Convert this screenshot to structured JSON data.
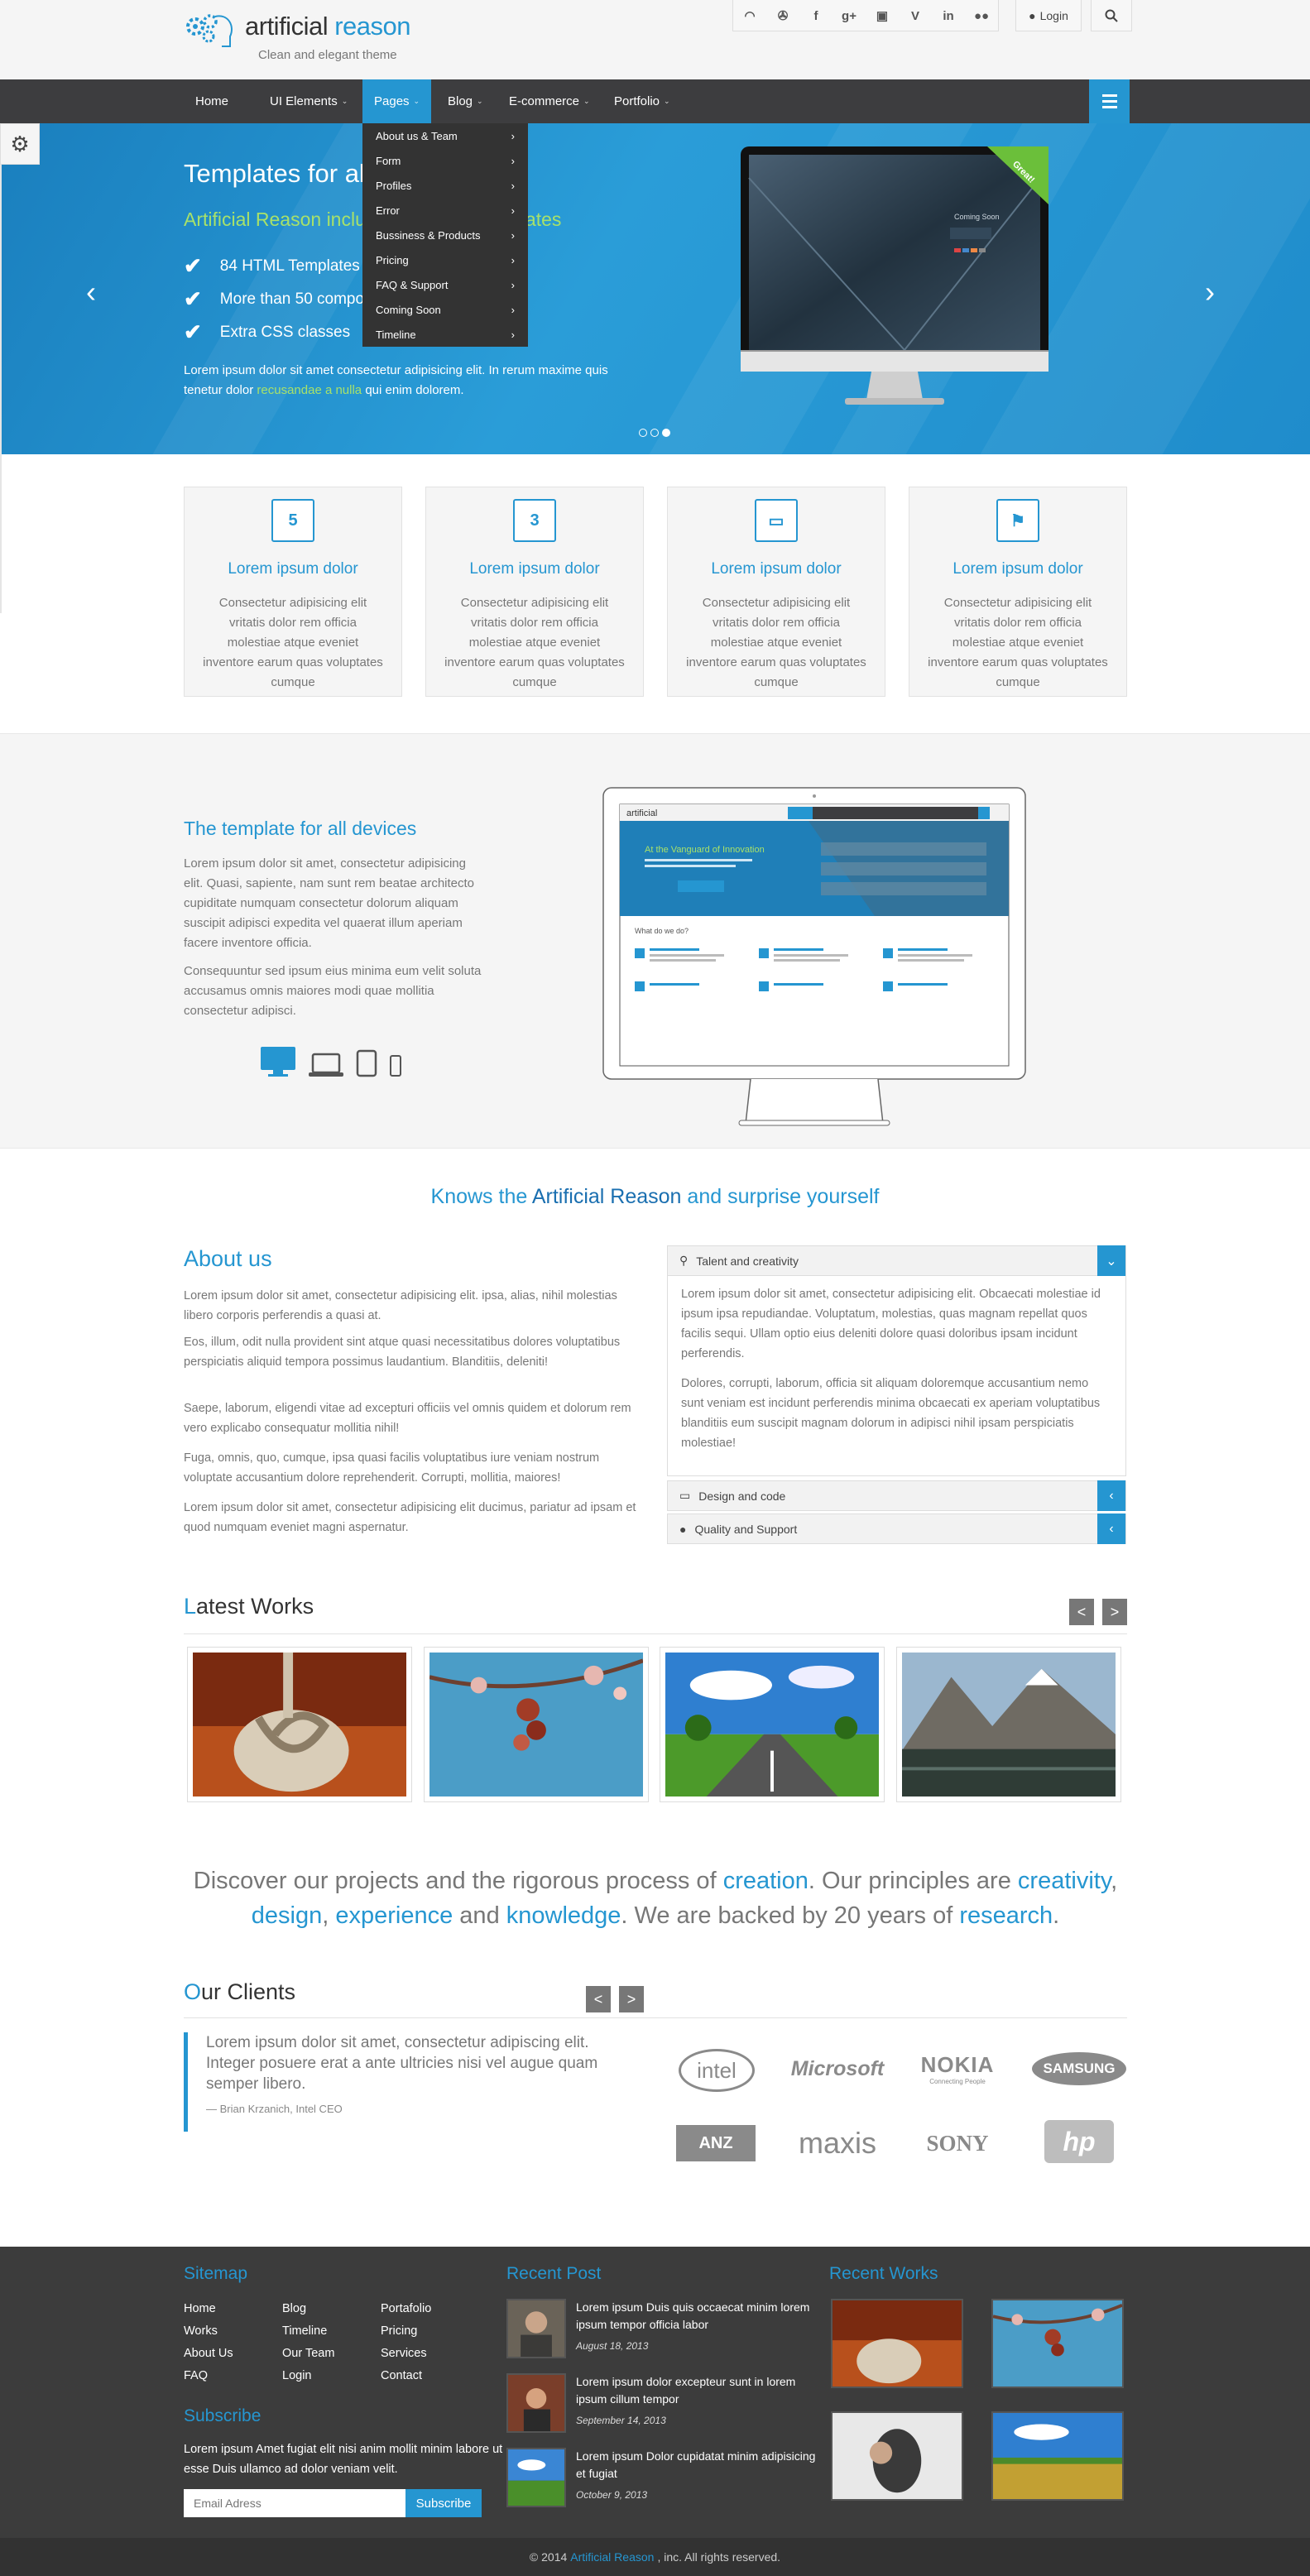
{
  "brand": {
    "title_part1": "artificial",
    "title_part2": "reason",
    "tagline": "Clean and elegant theme"
  },
  "topbar": {
    "social_icons": [
      "rss-icon",
      "twitter-icon",
      "facebook-icon",
      "google-plus-icon",
      "instagram-icon",
      "vine-icon",
      "linkedin-icon",
      "flickr-icon"
    ],
    "social_glyphs": [
      "◠",
      "✇",
      "f",
      "g+",
      "▣",
      "V",
      "in",
      "●●"
    ],
    "login": "Login"
  },
  "nav": {
    "items": [
      "Home",
      "UI Elements",
      "Pages",
      "Blog",
      "E-commerce",
      "Portfolio"
    ],
    "active": "Pages"
  },
  "dropdown": [
    "About us & Team",
    "Form",
    "Profiles",
    "Error",
    "Bussiness & Products",
    "Pricing",
    "FAQ & Support",
    "Coming Soon",
    "Timeline"
  ],
  "hero": {
    "title": "Templates for all devices",
    "subtitle": "Artificial Reason includes amazing templates",
    "checks": [
      "84 HTML Templates",
      "More than 50 components",
      "Extra CSS classes"
    ],
    "paragraph_a": "Lorem ipsum dolor sit amet consectetur adipisicing elit. In rerum maxime quis tenetur dolor ",
    "paragraph_link": "recusandae a nulla",
    "paragraph_b": " qui enim dolorem.",
    "ribbon": "Great!",
    "monitor_screen": "Coming Soon"
  },
  "features": [
    {
      "icon": "html5-icon",
      "glyph": "5",
      "title": "Lorem ipsum dolor",
      "text": "Consectetur adipisicing elit vritatis dolor rem officia molestiae atque eveniet inventore earum quas voluptates cumque"
    },
    {
      "icon": "css3-icon",
      "glyph": "3",
      "title": "Lorem ipsum dolor",
      "text": "Consectetur adipisicing elit vritatis dolor rem officia molestiae atque eveniet inventore earum quas voluptates cumque"
    },
    {
      "icon": "desktop-icon",
      "glyph": "▭",
      "title": "Lorem ipsum dolor",
      "text": "Consectetur adipisicing elit vritatis dolor rem officia molestiae atque eveniet inventore earum quas voluptates cumque"
    },
    {
      "icon": "flag-icon",
      "glyph": "⚑",
      "title": "Lorem ipsum dolor",
      "text": "Consectetur adipisicing elit vritatis dolor rem officia molestiae atque eveniet inventore earum quas voluptates cumque"
    }
  ],
  "devices": {
    "title": "The template for all devices",
    "p1": "Lorem ipsum dolor sit amet, consectetur adipisicing elit. Quasi, sapiente, nam sunt rem beatae architecto cupiditate numquam consectetur dolorum aliquam suscipit adipisci expedita vel quaerat illum aperiam facere inventore officia.",
    "p2": "Consequuntur sed ipsum eius minima eum velit soluta accusamus omnis maiores modi quae mollitia consectetur adipisci.",
    "screen_heading": "At the Vanguard of Innovation",
    "screen_sub": "What do we do?"
  },
  "knows": {
    "a": "Knows the ",
    "b": "Artificial Reason",
    "c": " and surprise yourself"
  },
  "about": {
    "title": "About us",
    "paragraphs": [
      "Lorem ipsum dolor sit amet, consectetur adipisicing elit. ipsa, alias, nihil molestias libero corporis perferendis a quasi at.",
      "Eos, illum, odit nulla provident sint atque quasi necessitatibus dolores voluptatibus perspiciatis aliquid tempora possimus laudantium. Blanditiis, deleniti!",
      "Saepe, laborum, eligendi vitae ad excepturi officiis vel omnis quidem et dolorum rem vero explicabo consequatur mollitia nihil!",
      "Fuga, omnis, quo, cumque, ipsa quasi facilis voluptatibus iure veniam nostrum voluptate accusantium dolore reprehenderit. Corrupti, mollitia, maiores!",
      "Lorem ipsum dolor sit amet, consectetur adipisicing elit ducimus, pariatur ad ipsam et quod numquam eveniet magni aspernatur."
    ]
  },
  "accordion": {
    "items": [
      "Talent and creativity",
      "Design and code",
      "Quality and Support"
    ],
    "open_p1": "Lorem ipsum dolor sit amet, consectetur adipisicing elit. Obcaecati molestiae id ipsum ipsa repudiandae. Voluptatum, molestias, quas magnam repellat quos facilis sequi. Ullam optio eius deleniti dolore quasi doloribus ipsam incidunt perferendis.",
    "open_p2": "Dolores, corrupti, laborum, officia sit aliquam doloremque accusantium nemo sunt veniam est incidunt perferendis minima obcaecati ex aperiam voluptatibus blanditiis eum suscipit magnam dolorum in adipisci nihil ipsam perspiciatis molestiae!"
  },
  "latest": {
    "first": "L",
    "rest": "atest Works",
    "prev": "<",
    "next": ">",
    "works": [
      "rope-knot",
      "pink-blossom",
      "country-road",
      "mountain-lake"
    ]
  },
  "discover": {
    "parts": [
      {
        "t": "Discover our projects and the rigorous process of ",
        "hl": false
      },
      {
        "t": "creation",
        "hl": true
      },
      {
        "t": ". Our principles are ",
        "hl": false
      },
      {
        "t": "creativity",
        "hl": true
      },
      {
        "t": ", ",
        "hl": false
      },
      {
        "t": "design",
        "hl": true
      },
      {
        "t": ", ",
        "hl": false
      },
      {
        "t": "experience",
        "hl": true
      },
      {
        "t": " and ",
        "hl": false
      },
      {
        "t": "knowledge",
        "hl": true
      },
      {
        "t": ". We are backed by 20 years of ",
        "hl": false
      },
      {
        "t": "research",
        "hl": true
      },
      {
        "t": ".",
        "hl": false
      }
    ]
  },
  "clients": {
    "first": "O",
    "rest": "ur Clients",
    "prev": "<",
    "next": ">",
    "quote": "Lorem ipsum dolor sit amet, consectetur adipiscing elit. Integer posuere erat a ante ultricies nisi vel augue quam semper libero.",
    "by": "— Brian Krzanich, Intel CEO",
    "logos": [
      "intel",
      "Microsoft",
      "NOKIA",
      "SAMSUNG",
      "ANZ",
      "maxis",
      "SONY",
      "hp"
    ],
    "nokia_sub": "Connecting People"
  },
  "footer": {
    "sitemap_title": "Sitemap",
    "sitemap": [
      [
        "Home",
        "Works",
        "About Us",
        "FAQ"
      ],
      [
        "Blog",
        "Timeline",
        "Our Team",
        "Login"
      ],
      [
        "Portafolio",
        "Pricing",
        "Services",
        "Contact"
      ]
    ],
    "subscribe_title": "Subscribe",
    "subscribe_text": "Lorem ipsum Amet fugiat elit nisi anim mollit minim labore ut esse Duis ullamco ad dolor veniam velit.",
    "email_placeholder": "Email Adress",
    "subscribe_btn": "Subscribe",
    "recent_post_title": "Recent Post",
    "posts": [
      {
        "title": "Lorem ipsum Duis quis occaecat minim lorem ipsum tempor officia labor",
        "date": "August 18, 2013"
      },
      {
        "title": "Lorem ipsum dolor excepteur sunt in lorem ipsum cillum tempor",
        "date": "September 14, 2013"
      },
      {
        "title": "Lorem ipsum Dolor cupidatat minim adipisicing et fugiat",
        "date": "October 9, 2013"
      }
    ],
    "recent_works_title": "Recent Works",
    "copyright_a": "© 2014 ",
    "copyright_b": "Artificial Reason",
    "copyright_c": ", inc. All rights reserved."
  },
  "colors": {
    "accent": "#2596d1",
    "dark": "#3d3d3f",
    "footer": "#3c3c3c",
    "hero_green": "#a7e16a"
  }
}
